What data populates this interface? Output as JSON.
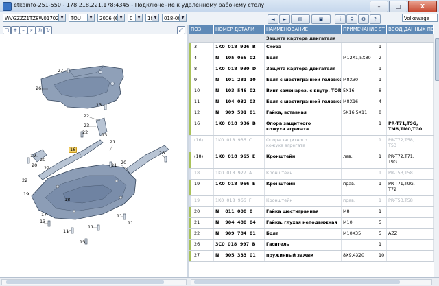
{
  "window": {
    "title": "etkainfo-251-550 - 178.218.221.178:4345 - Подключение к удаленному рабочему столу",
    "minimize": "–",
    "maximize": "□",
    "close": "X"
  },
  "toolbar": {
    "vin": "WVGZZZ1TZ8W01702",
    "model": "TOU",
    "year": "2006 (6)",
    "field_a": "0",
    "field_b": "18",
    "field_c": "018-000",
    "brand": "Volkswage"
  },
  "diagram": {
    "callouts": [
      "27",
      "26",
      "13",
      "22",
      "23",
      "22",
      "13",
      "16",
      "20",
      "19",
      "20",
      "20",
      "22",
      "21",
      "21",
      "26",
      "22",
      "19",
      "13",
      "11",
      "13",
      "11",
      "11",
      "18",
      "11",
      "17"
    ]
  },
  "table": {
    "columns": [
      "ПОЗ.",
      "НОМЕР ДЕТАЛИ",
      "НАИМЕНОВАНИЕ",
      "ПРИМЕЧАНИЕ",
      "ST",
      "ВВОД ДАННЫХ ПО"
    ],
    "rows": [
      {
        "pos": "",
        "part": "",
        "name": "Защита картера двигателя",
        "note": "",
        "qty": "",
        "data": "",
        "type": "head"
      },
      {
        "pos": "3",
        "part": "1K0  018  926  B",
        "name": "Скоба",
        "note": "",
        "qty": "1",
        "data": "",
        "type": "normal"
      },
      {
        "pos": "4",
        "part": "N    105  056  02",
        "name": "Болт",
        "note": "M12X1,5X80",
        "qty": "2",
        "data": "",
        "type": "normal"
      },
      {
        "pos": "8",
        "part": "1K0  018  930  D",
        "name": "Защита картера двигателя",
        "note": "",
        "qty": "1",
        "data": "",
        "type": "normal"
      },
      {
        "pos": "9",
        "part": "N    101  281  10",
        "name": "Болт с шестигранной головкой",
        "note": "M8X30",
        "qty": "1",
        "data": "",
        "type": "normal"
      },
      {
        "pos": "10",
        "part": "N    103  546  02",
        "name": "Винт самонарез. с внутр. TORX",
        "note": "5X16",
        "qty": "8",
        "data": "",
        "type": "normal"
      },
      {
        "pos": "11",
        "part": "N    104  032  03",
        "name": "Болт с шестигранной головкой",
        "note": "M8X16",
        "qty": "4",
        "data": "",
        "type": "normal"
      },
      {
        "pos": "12",
        "part": "N    909  591  01",
        "name": "Гайка, вставная",
        "note": "5X16,5X11",
        "qty": "8",
        "data": "",
        "type": "normal"
      },
      {
        "pos": "16",
        "part": "1K0  018  936  B",
        "name": "Опора защитного\nкожуха агрегата",
        "note": "",
        "qty": "1",
        "data": "PR-T71,T9G,\nTM8,TM0,TG0",
        "type": "hi"
      },
      {
        "pos": "(16)",
        "part": "1K0  018  936  C",
        "name": "Опора защитного\nкожуха агрегата",
        "note": "",
        "qty": "1",
        "data": "PR-T72,T58,\nT53",
        "type": "dim"
      },
      {
        "pos": "(18)",
        "part": "1K0  018  965  E",
        "name": "Кронштейн",
        "note": "лев.",
        "qty": "1",
        "data": "PR-T72,T71,\nT9G",
        "type": "normal"
      },
      {
        "pos": "18",
        "part": "1K0  018  927  A",
        "name": "Кронштейн",
        "note": "",
        "qty": "1",
        "data": "PR-T53,T58",
        "type": "dim"
      },
      {
        "pos": "19",
        "part": "1K0  018  966  E",
        "name": "Кронштейн",
        "note": "прав.",
        "qty": "1",
        "data": "PR-T71,T9G,\nT72",
        "type": "normal"
      },
      {
        "pos": "19",
        "part": "1K0  018  966  F",
        "name": "Кронштейн",
        "note": "прав.",
        "qty": "1",
        "data": "PR-T53,T58",
        "type": "dim"
      },
      {
        "pos": "20",
        "part": "N    011  008  8",
        "name": "Гайка шестигранная",
        "note": "M8",
        "qty": "1",
        "data": "",
        "type": "normal"
      },
      {
        "pos": "21",
        "part": "N    904  480  04",
        "name": "Гайка, глухая неподвижная",
        "note": "M10",
        "qty": "5",
        "data": "",
        "type": "normal"
      },
      {
        "pos": "22",
        "part": "N    909  784  01",
        "name": "Болт",
        "note": "M10X35",
        "qty": "5",
        "data": "AZZ",
        "type": "normal"
      },
      {
        "pos": "26",
        "part": "3C0  018  997  B",
        "name": "Гаситель",
        "note": "",
        "qty": "1",
        "data": "",
        "type": "normal"
      },
      {
        "pos": "27",
        "part": "N    905  333  01",
        "name": "пружинный зажим",
        "note": "8X9,4X20",
        "qty": "10",
        "data": "",
        "type": "normal"
      }
    ]
  },
  "colors": {
    "header": "#5f8ab7",
    "marker": "#a9c259",
    "highlight_outline": "#6a8fbd"
  }
}
